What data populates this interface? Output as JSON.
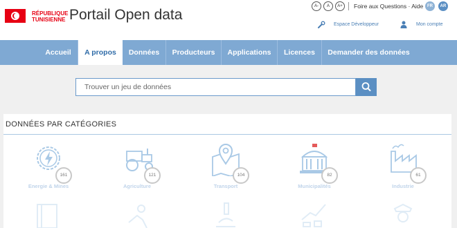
{
  "header": {
    "logo_text_line1": "RÉPUBLIQUE",
    "logo_text_line2": "TUNISIENNE",
    "title": "Portail Open data",
    "accessibility": [
      "A-",
      "A",
      "A+"
    ],
    "faq_label": "Foire aux Questions",
    "dot": "·",
    "help_label": "Aide",
    "languages": [
      "FR",
      "AR"
    ],
    "developer_label": "Espace Développeur",
    "account_label": "Mon compte"
  },
  "nav": {
    "items": [
      "Accueil",
      "A propos",
      "Données",
      "Producteurs",
      "Applications",
      "Licences",
      "Demander des données"
    ],
    "active": "A propos"
  },
  "search": {
    "placeholder": "Trouver un jeu de données",
    "button_icon": "search-icon"
  },
  "categories_panel": {
    "title": "DONNÉES PAR CATÉGORIES",
    "items": [
      {
        "label": "Energie & Mines",
        "count": "161",
        "icon": "lightning-gear-icon"
      },
      {
        "label": "Agriculture",
        "count": "121",
        "icon": "tractor-icon"
      },
      {
        "label": "Transport",
        "count": "104",
        "icon": "map-pin-icon"
      },
      {
        "label": "Municipalités",
        "count": "82",
        "icon": "municipal-building-icon"
      },
      {
        "label": "Industrie",
        "count": "61",
        "icon": "factory-icon"
      }
    ]
  },
  "colors": {
    "nav_bg": "#7fa9d3",
    "accent": "#5b8fc3",
    "flag_red": "#e70013"
  }
}
